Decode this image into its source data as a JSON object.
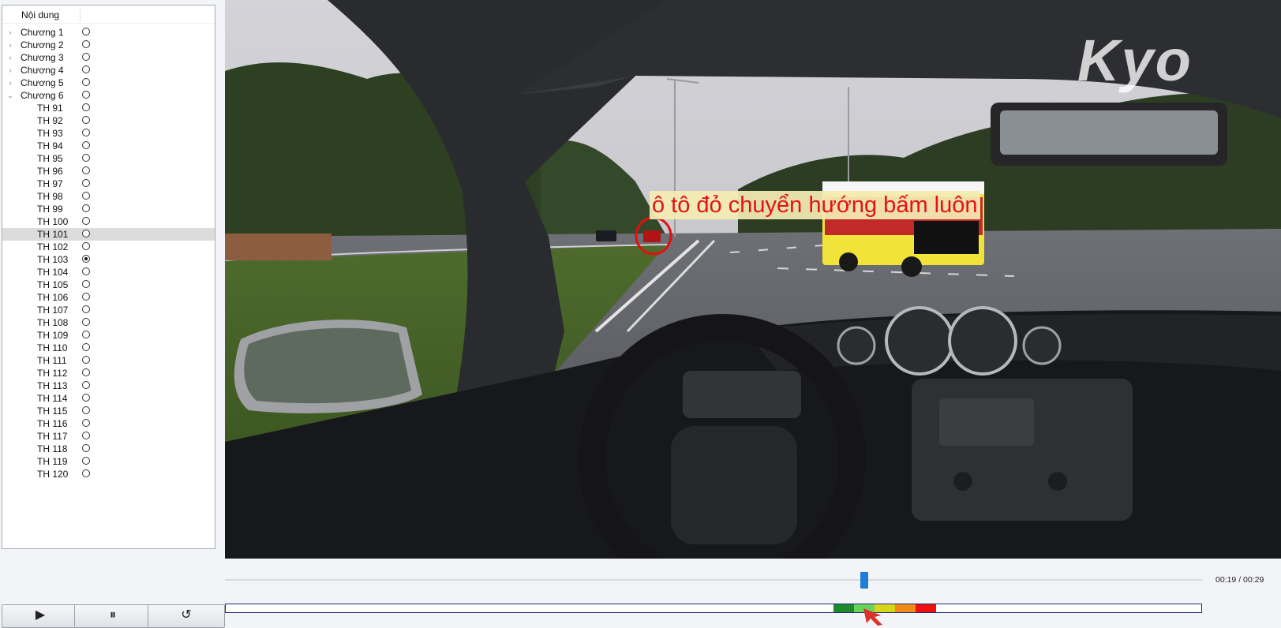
{
  "tree": {
    "header": "Nội dung",
    "chapters": [
      {
        "label": "Chương 1",
        "expanded": false
      },
      {
        "label": "Chương 2",
        "expanded": false
      },
      {
        "label": "Chương 3",
        "expanded": false
      },
      {
        "label": "Chương 4",
        "expanded": false
      },
      {
        "label": "Chương 5",
        "expanded": false
      },
      {
        "label": "Chương 6",
        "expanded": true
      }
    ],
    "expanded_items": [
      "TH 91",
      "TH 92",
      "TH 93",
      "TH 94",
      "TH 95",
      "TH 96",
      "TH 97",
      "TH 98",
      "TH 99",
      "TH 100",
      "TH 101",
      "TH 102",
      "TH 103",
      "TH 104",
      "TH 105",
      "TH 106",
      "TH 107",
      "TH 108",
      "TH 109",
      "TH 110",
      "TH 111",
      "TH 112",
      "TH 113",
      "TH 114",
      "TH 115",
      "TH 116",
      "TH 117",
      "TH 118",
      "TH 119",
      "TH 120"
    ],
    "highlighted_item": "TH 101",
    "checked_item": "TH 103"
  },
  "video": {
    "caption": "ô tô đỏ chuyển hướng bấm luôn",
    "watermark": "Kyo"
  },
  "player": {
    "time": "00:19 / 00:29",
    "progress": 0.6552
  },
  "score_bar": {
    "segments": [
      {
        "color": "#1e8a2e"
      },
      {
        "color": "#6ad35a"
      },
      {
        "color": "#d7d718"
      },
      {
        "color": "#f08a16"
      },
      {
        "color": "#ee0f0f"
      }
    ],
    "marker_color": "#d9322b"
  },
  "controls": {
    "play_icon": "play-icon",
    "play_glyph": "▶",
    "pause_icon": "pause-icon",
    "pause_glyph": "⏸",
    "replay_icon": "replay-icon",
    "replay_glyph": "↺"
  }
}
